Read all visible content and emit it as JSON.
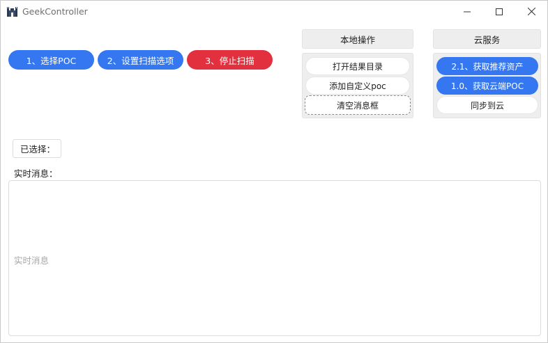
{
  "window": {
    "title": "GeekController",
    "app_icon": "castle-icon",
    "controls": [
      "minimize-icon",
      "maximize-icon",
      "close-icon"
    ]
  },
  "actions": {
    "select_poc": "1、选择POC",
    "scan_settings": "2、设置扫描选项",
    "stop_scan": "3、停止扫描"
  },
  "local_ops": {
    "header": "本地操作",
    "open_results_dir": "打开结果目录",
    "add_custom_poc": "添加自定义poc",
    "clear_messages": "清空消息框"
  },
  "cloud_service": {
    "header": "云服务",
    "get_recommended_assets": "2.1、获取推荐资产",
    "get_cloud_poc": "1.0、获取云端POC",
    "sync_to_cloud": "同步到云"
  },
  "selected": {
    "label": "已选择："
  },
  "messages": {
    "label": "实时消息：",
    "placeholder": "实时消息",
    "value": ""
  },
  "colors": {
    "primary_blue": "#3577f1",
    "danger_red": "#e3303e",
    "panel_gray": "#eeeeee"
  }
}
